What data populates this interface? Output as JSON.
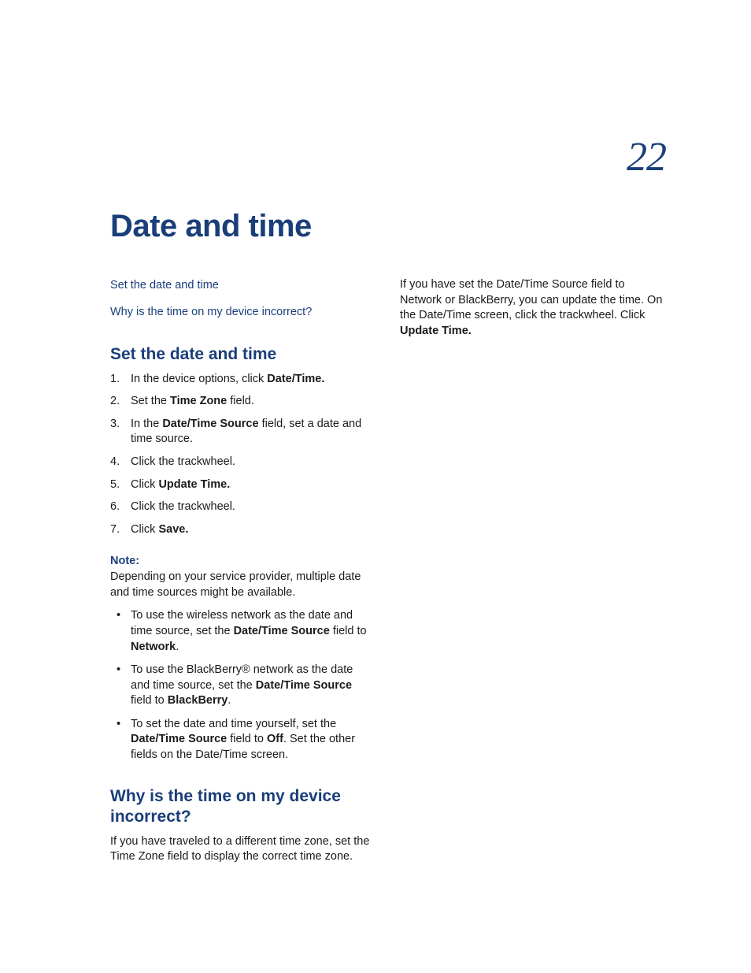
{
  "chapter": {
    "number": "22",
    "title": "Date and time"
  },
  "toc": {
    "link1": "Set the date and time",
    "link2": "Why is the time on my device incorrect?"
  },
  "section1": {
    "heading": "Set the date and time",
    "steps": {
      "s1_a": "In the device options, click ",
      "s1_b": "Date/Time.",
      "s2_a": "Set the ",
      "s2_b": "Time Zone",
      "s2_c": " field.",
      "s3_a": "In the ",
      "s3_b": "Date/Time Source",
      "s3_c": " field, set a date and time source.",
      "s4": "Click the trackwheel.",
      "s5_a": "Click ",
      "s5_b": "Update Time.",
      "s6": "Click the trackwheel.",
      "s7_a": "Click ",
      "s7_b": "Save."
    },
    "note_label": "Note:",
    "note_text": "Depending on your service provider, multiple date and time sources might be available.",
    "bullets": {
      "b1_a": "To use the wireless network as the date and time source, set the ",
      "b1_b": "Date/Time Source",
      "b1_c": " field to ",
      "b1_d": "Network",
      "b1_e": ".",
      "b2_a": "To use the BlackBerry® network as the date and time source, set the ",
      "b2_b": "Date/Time Source",
      "b2_c": " field to ",
      "b2_d": "BlackBerry",
      "b2_e": ".",
      "b3_a": "To set the date and time yourself, set the ",
      "b3_b": "Date/Time Source",
      "b3_c": " field to ",
      "b3_d": "Off",
      "b3_e": ". Set the other fields on the Date/Time screen."
    }
  },
  "section2": {
    "heading": "Why is the time on my device incorrect?",
    "p1": "If you have traveled to a different time zone, set the Time Zone field to display the correct time zone."
  },
  "right_col": {
    "p1_a": "If you have set the Date/Time Source field to Network or BlackBerry, you can update the time. On the Date/Time screen, click the trackwheel. Click ",
    "p1_b": "Update Time."
  }
}
